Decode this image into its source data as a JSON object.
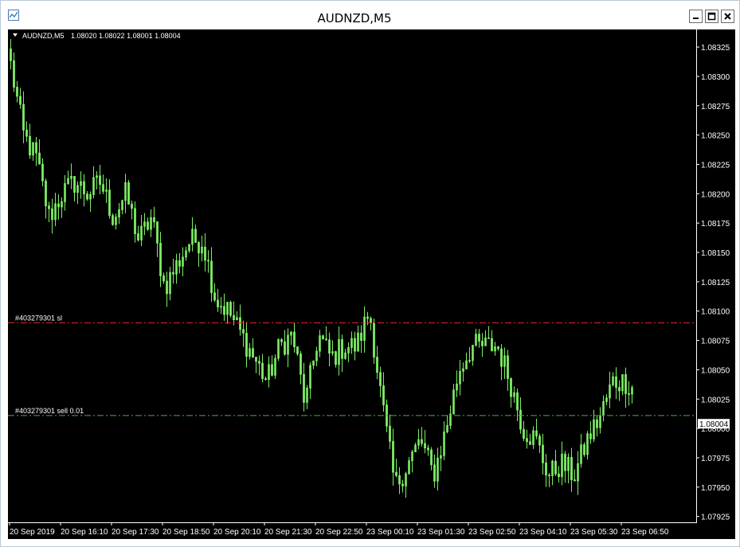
{
  "window": {
    "title": "AUDNZD,M5"
  },
  "header": {
    "symbol_label": "AUDNZD,M5",
    "ohlc_label": "1.08020 1.08022 1.08001 1.08004"
  },
  "lines": {
    "sl_label": "#403279301 sl",
    "sl_price": 1.0809,
    "order_label": "#403279301 sell 0.01",
    "order_price": 1.08011,
    "current_price_label": "1.08004",
    "current_price": 1.08004
  },
  "colors": {
    "candle": "#7dee63",
    "sl_line": "#e2262a",
    "order_line": "#41b43b",
    "vline": "#ffff5b",
    "background": "#000000",
    "axis": "#ffffff"
  },
  "icons": {
    "app": "chart-window-icon",
    "minimize": "minimize-icon",
    "maximize": "maximize-icon",
    "close": "close-icon",
    "symbol_menu": "triangle-down-icon"
  },
  "chart_data": {
    "type": "candlestick",
    "symbol": "AUDNZD",
    "timeframe": "M5",
    "ylim": [
      1.0792,
      1.0834
    ],
    "y_ticks": [
      "1.08325",
      "1.08300",
      "1.08275",
      "1.08250",
      "1.08225",
      "1.08200",
      "1.08175",
      "1.08150",
      "1.08125",
      "1.08100",
      "1.08075",
      "1.08050",
      "1.08025",
      "1.08000",
      "1.07975",
      "1.07950",
      "1.07925"
    ],
    "x_ticks": [
      "20 Sep 2019",
      "20 Sep 16:10",
      "20 Sep 17:30",
      "20 Sep 18:50",
      "20 Sep 20:10",
      "20 Sep 21:30",
      "20 Sep 22:50",
      "23 Sep 00:10",
      "23 Sep 01:30",
      "23 Sep 02:50",
      "23 Sep 04:10",
      "23 Sep 05:30",
      "23 Sep 06:50"
    ],
    "bars_per_tick": 16,
    "last_close": 1.08004,
    "close_path": [
      1.0831,
      1.0825,
      1.0823,
      1.0818,
      1.082,
      1.0821,
      1.082,
      1.0821,
      1.0818,
      1.082,
      1.0816,
      1.0818,
      1.0812,
      1.0814,
      1.0816,
      1.0816,
      1.0811,
      1.081,
      1.0808,
      1.0806,
      1.0804,
      1.0807,
      1.0808,
      1.0802,
      1.0808,
      1.0806,
      1.0807,
      1.0807,
      1.081,
      1.0802,
      1.0795,
      1.0797,
      1.0799,
      1.0796,
      1.08,
      1.0805,
      1.0807,
      1.0807,
      1.0807,
      1.0804,
      1.08,
      1.0799,
      1.0796,
      1.0797,
      1.0796,
      1.0799,
      1.0801,
      1.0804,
      1.0804,
      1.0803
    ],
    "vertical_line_bar": 353
  }
}
